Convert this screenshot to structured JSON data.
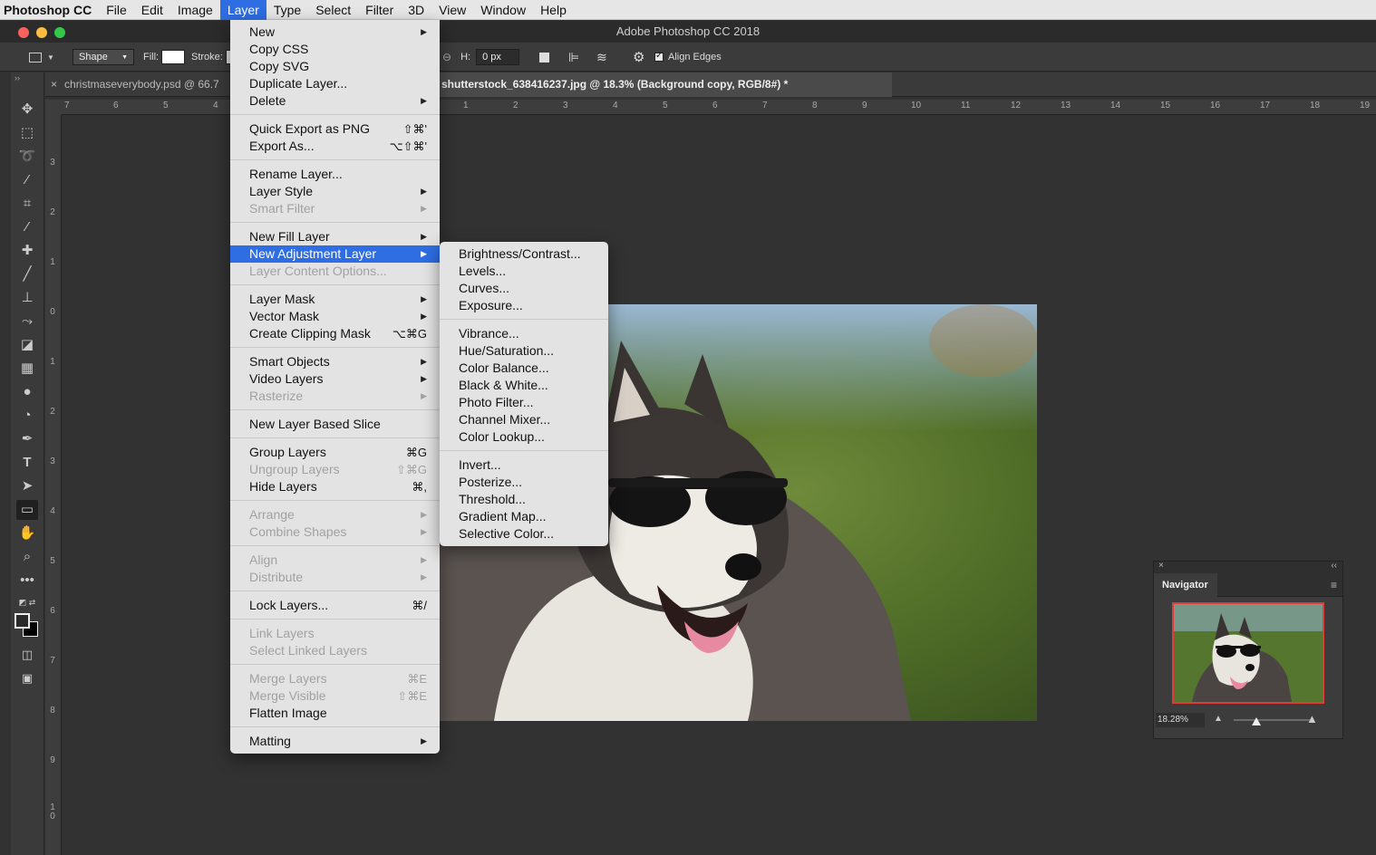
{
  "menubar": {
    "apple": "",
    "app": "Photoshop CC",
    "items": [
      "File",
      "Edit",
      "Image",
      "Layer",
      "Type",
      "Select",
      "Filter",
      "3D",
      "View",
      "Window",
      "Help"
    ],
    "active": "Layer"
  },
  "window": {
    "title": "Adobe Photoshop CC 2018"
  },
  "options": {
    "shape_mode": "Shape",
    "fill_label": "Fill:",
    "stroke_label": "Stroke:",
    "h_label": "H:",
    "h_value": "0 px",
    "align_edges": "Align Edges",
    "align_edges_checked": true
  },
  "tabs": [
    {
      "label": "christmaseverybody.psd @ 66.7",
      "close": "×",
      "active": false
    },
    {
      "label": "shutterstock_638416237.jpg @ 18.3% (Background copy, RGB/8#) *",
      "active": true
    }
  ],
  "ruler": {
    "top": [
      "7",
      "6",
      "5",
      "4",
      "1",
      "2",
      "3",
      "4",
      "5",
      "6",
      "7",
      "8",
      "9",
      "10",
      "11",
      "12",
      "13",
      "14",
      "15",
      "16",
      "17",
      "18",
      "19"
    ],
    "left": [
      "3",
      "2",
      "1",
      "0",
      "1",
      "2",
      "3",
      "4",
      "5",
      "6",
      "7",
      "8",
      "9",
      "1\n0"
    ]
  },
  "layer_menu": {
    "groups": [
      [
        {
          "label": "New",
          "submenu": true
        },
        {
          "label": "Copy CSS"
        },
        {
          "label": "Copy SVG"
        },
        {
          "label": "Duplicate Layer..."
        },
        {
          "label": "Delete",
          "submenu": true
        }
      ],
      [
        {
          "label": "Quick Export as PNG",
          "shortcut": "⇧⌘'"
        },
        {
          "label": "Export As...",
          "shortcut": "⌥⇧⌘'"
        }
      ],
      [
        {
          "label": "Rename Layer..."
        },
        {
          "label": "Layer Style",
          "submenu": true
        },
        {
          "label": "Smart Filter",
          "submenu": true,
          "disabled": true
        }
      ],
      [
        {
          "label": "New Fill Layer",
          "submenu": true
        },
        {
          "label": "New Adjustment Layer",
          "submenu": true,
          "highlighted": true
        },
        {
          "label": "Layer Content Options...",
          "disabled": true
        }
      ],
      [
        {
          "label": "Layer Mask",
          "submenu": true
        },
        {
          "label": "Vector Mask",
          "submenu": true
        },
        {
          "label": "Create Clipping Mask",
          "shortcut": "⌥⌘G"
        }
      ],
      [
        {
          "label": "Smart Objects",
          "submenu": true
        },
        {
          "label": "Video Layers",
          "submenu": true
        },
        {
          "label": "Rasterize",
          "submenu": true,
          "disabled": true
        }
      ],
      [
        {
          "label": "New Layer Based Slice"
        }
      ],
      [
        {
          "label": "Group Layers",
          "shortcut": "⌘G"
        },
        {
          "label": "Ungroup Layers",
          "shortcut": "⇧⌘G",
          "disabled": true
        },
        {
          "label": "Hide Layers",
          "shortcut": "⌘,"
        }
      ],
      [
        {
          "label": "Arrange",
          "submenu": true,
          "disabled": true
        },
        {
          "label": "Combine Shapes",
          "submenu": true,
          "disabled": true
        }
      ],
      [
        {
          "label": "Align",
          "submenu": true,
          "disabled": true
        },
        {
          "label": "Distribute",
          "submenu": true,
          "disabled": true
        }
      ],
      [
        {
          "label": "Lock Layers...",
          "shortcut": "⌘/"
        }
      ],
      [
        {
          "label": "Link Layers",
          "disabled": true
        },
        {
          "label": "Select Linked Layers",
          "disabled": true
        }
      ],
      [
        {
          "label": "Merge Layers",
          "shortcut": "⌘E",
          "disabled": true
        },
        {
          "label": "Merge Visible",
          "shortcut": "⇧⌘E",
          "disabled": true
        },
        {
          "label": "Flatten Image"
        }
      ],
      [
        {
          "label": "Matting",
          "submenu": true
        }
      ]
    ]
  },
  "adjustment_menu": {
    "groups": [
      [
        {
          "label": "Brightness/Contrast..."
        },
        {
          "label": "Levels..."
        },
        {
          "label": "Curves..."
        },
        {
          "label": "Exposure..."
        }
      ],
      [
        {
          "label": "Vibrance..."
        },
        {
          "label": "Hue/Saturation..."
        },
        {
          "label": "Color Balance..."
        },
        {
          "label": "Black & White..."
        },
        {
          "label": "Photo Filter..."
        },
        {
          "label": "Channel Mixer..."
        },
        {
          "label": "Color Lookup..."
        }
      ],
      [
        {
          "label": "Invert..."
        },
        {
          "label": "Posterize..."
        },
        {
          "label": "Threshold..."
        },
        {
          "label": "Gradient Map..."
        },
        {
          "label": "Selective Color..."
        }
      ]
    ]
  },
  "tools": [
    "move-icon",
    "marquee-icon",
    "lasso-icon",
    "quick-select-icon",
    "crop-icon",
    "eyedropper-icon",
    "healing-brush-icon",
    "brush-icon",
    "clone-stamp-icon",
    "history-brush-icon",
    "eraser-icon",
    "gradient-icon",
    "blur-icon",
    "dodge-icon",
    "pen-icon",
    "type-icon",
    "path-select-icon",
    "rectangle-icon",
    "hand-icon",
    "zoom-icon",
    "more-tools-icon"
  ],
  "navigator": {
    "title": "Navigator",
    "close": "×",
    "collapse": "‹‹",
    "zoom": "18.28%",
    "zoom_level": 0.28
  },
  "colors": {
    "menu_highlight": "#2e6ee2",
    "menu_bg": "#e3e3e3",
    "workspace_bg": "#323232",
    "navigator_frame": "#e03c3c"
  }
}
